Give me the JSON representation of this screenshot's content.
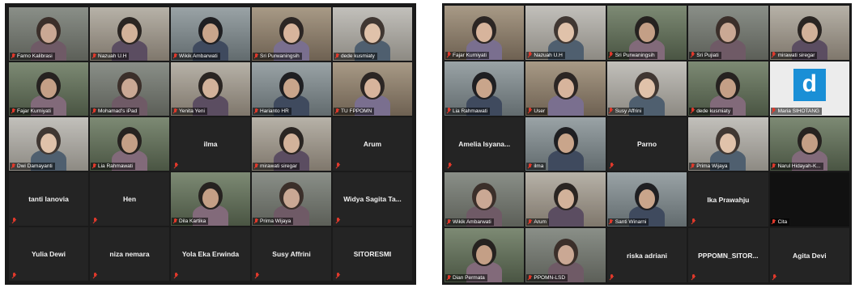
{
  "colors": {
    "panel_bg": "#1a1a1a",
    "tile_bg": "#242424",
    "active_border": "#e5e08a",
    "muted_mic": "#e0392b",
    "name_text": "#f2f2f2"
  },
  "left_panel": {
    "tiles": [
      {
        "name": "Farno Kalibrasi",
        "type": "video",
        "active": true
      },
      {
        "name": "Nazuah U.H",
        "type": "video"
      },
      {
        "name": "Wikik Ambarwati",
        "type": "video"
      },
      {
        "name": "Sri Purwaningsih",
        "type": "video"
      },
      {
        "name": "dede kusmiaty",
        "type": "video"
      },
      {
        "name": "Fajar Kurniyati",
        "type": "video"
      },
      {
        "name": "Mohamad's iPad",
        "type": "video"
      },
      {
        "name": "Yenita Yeni",
        "type": "video"
      },
      {
        "name": "Harianto HR",
        "type": "video"
      },
      {
        "name": "TU FPPOMN",
        "type": "video"
      },
      {
        "name": "Dwi Damayanti",
        "type": "video"
      },
      {
        "name": "Lia Rahmawati",
        "type": "video"
      },
      {
        "name": "ilma",
        "type": "name"
      },
      {
        "name": "mirawati siregar",
        "type": "video"
      },
      {
        "name": "Arum",
        "type": "name"
      },
      {
        "name": "tanti lanovia",
        "type": "name"
      },
      {
        "name": "Hen",
        "type": "name"
      },
      {
        "name": "Dila Kartika",
        "type": "video"
      },
      {
        "name": "Prima Wijaya",
        "type": "video"
      },
      {
        "name": "Widya Sagita Ta...",
        "type": "name"
      },
      {
        "name": "Yulia Dewi",
        "type": "name"
      },
      {
        "name": "niza nemara",
        "type": "name"
      },
      {
        "name": "Yola Eka Erwinda",
        "type": "name"
      },
      {
        "name": "Susy Affrini",
        "type": "name"
      },
      {
        "name": "SITORESMI",
        "type": "name"
      }
    ]
  },
  "right_panel": {
    "tiles": [
      {
        "name": "Fajar Kurniyati",
        "type": "video"
      },
      {
        "name": "Nazuah U.H",
        "type": "video"
      },
      {
        "name": "Sri Purwaningsih",
        "type": "video"
      },
      {
        "name": "Sri Pujiati",
        "type": "video"
      },
      {
        "name": "mirawati siregar",
        "type": "video"
      },
      {
        "name": "Lia Rahmawati",
        "type": "video"
      },
      {
        "name": "User",
        "type": "video"
      },
      {
        "name": "Susy Affrini",
        "type": "video"
      },
      {
        "name": "dede kusmiaty",
        "type": "video"
      },
      {
        "name": "Maria SIHOTANG",
        "type": "logo",
        "logo_letter": "d"
      },
      {
        "name": "Amelia Isyana...",
        "type": "name"
      },
      {
        "name": "ilma",
        "type": "video",
        "active": true
      },
      {
        "name": "Parno",
        "type": "name"
      },
      {
        "name": "Prima Wijaya",
        "type": "video"
      },
      {
        "name": "Narul Hidayah-K...",
        "type": "video"
      },
      {
        "name": "Wikik Ambarwati",
        "type": "video"
      },
      {
        "name": "Arum",
        "type": "video"
      },
      {
        "name": "Santi Winarni",
        "type": "video"
      },
      {
        "name": "Ika Prawahju",
        "type": "name"
      },
      {
        "name": "Cita",
        "type": "empty"
      },
      {
        "name": "Dian Permata",
        "type": "video"
      },
      {
        "name": "PPOMN-LSD",
        "type": "video"
      },
      {
        "name": "riska adriani",
        "type": "name"
      },
      {
        "name": "PPPOMN_SITOR...",
        "type": "name"
      },
      {
        "name": "Agita Devi",
        "type": "name"
      }
    ]
  }
}
